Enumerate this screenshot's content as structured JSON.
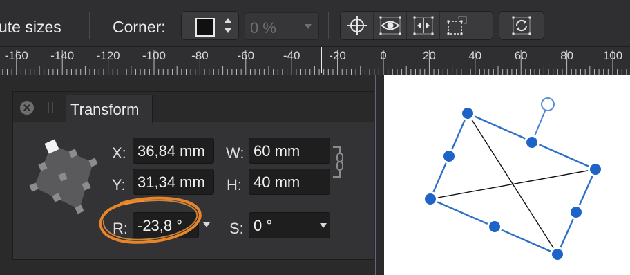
{
  "toolbar": {
    "partial_label": "ute sizes",
    "corner_label": "Corner:",
    "corner_amount": "0 %",
    "tools": [
      {
        "icon": "crosshair-icon"
      },
      {
        "icon": "eye-icon"
      },
      {
        "icon": "flip-icon"
      },
      {
        "icon": "transform-origin-icon"
      },
      {
        "icon": "cycle-icon"
      }
    ]
  },
  "ruler": {
    "labels": [
      "-160",
      "-140",
      "-120",
      "-100",
      "-80",
      "-60",
      "-40",
      "-20",
      "0",
      "20",
      "40",
      "60",
      "80",
      "100"
    ]
  },
  "panel": {
    "title": "Transform",
    "x_label": "X:",
    "x_value": "36,84 mm",
    "y_label": "Y:",
    "y_value": "31,34 mm",
    "w_label": "W:",
    "w_value": "60 mm",
    "h_label": "H:",
    "h_value": "40 mm",
    "r_label": "R:",
    "r_value": "-23,8 °",
    "s_label": "S:",
    "s_value": "0 °"
  },
  "colors": {
    "highlight": "#e8842a",
    "selection": "#2f6fc8",
    "handle": "#1d63c8"
  }
}
